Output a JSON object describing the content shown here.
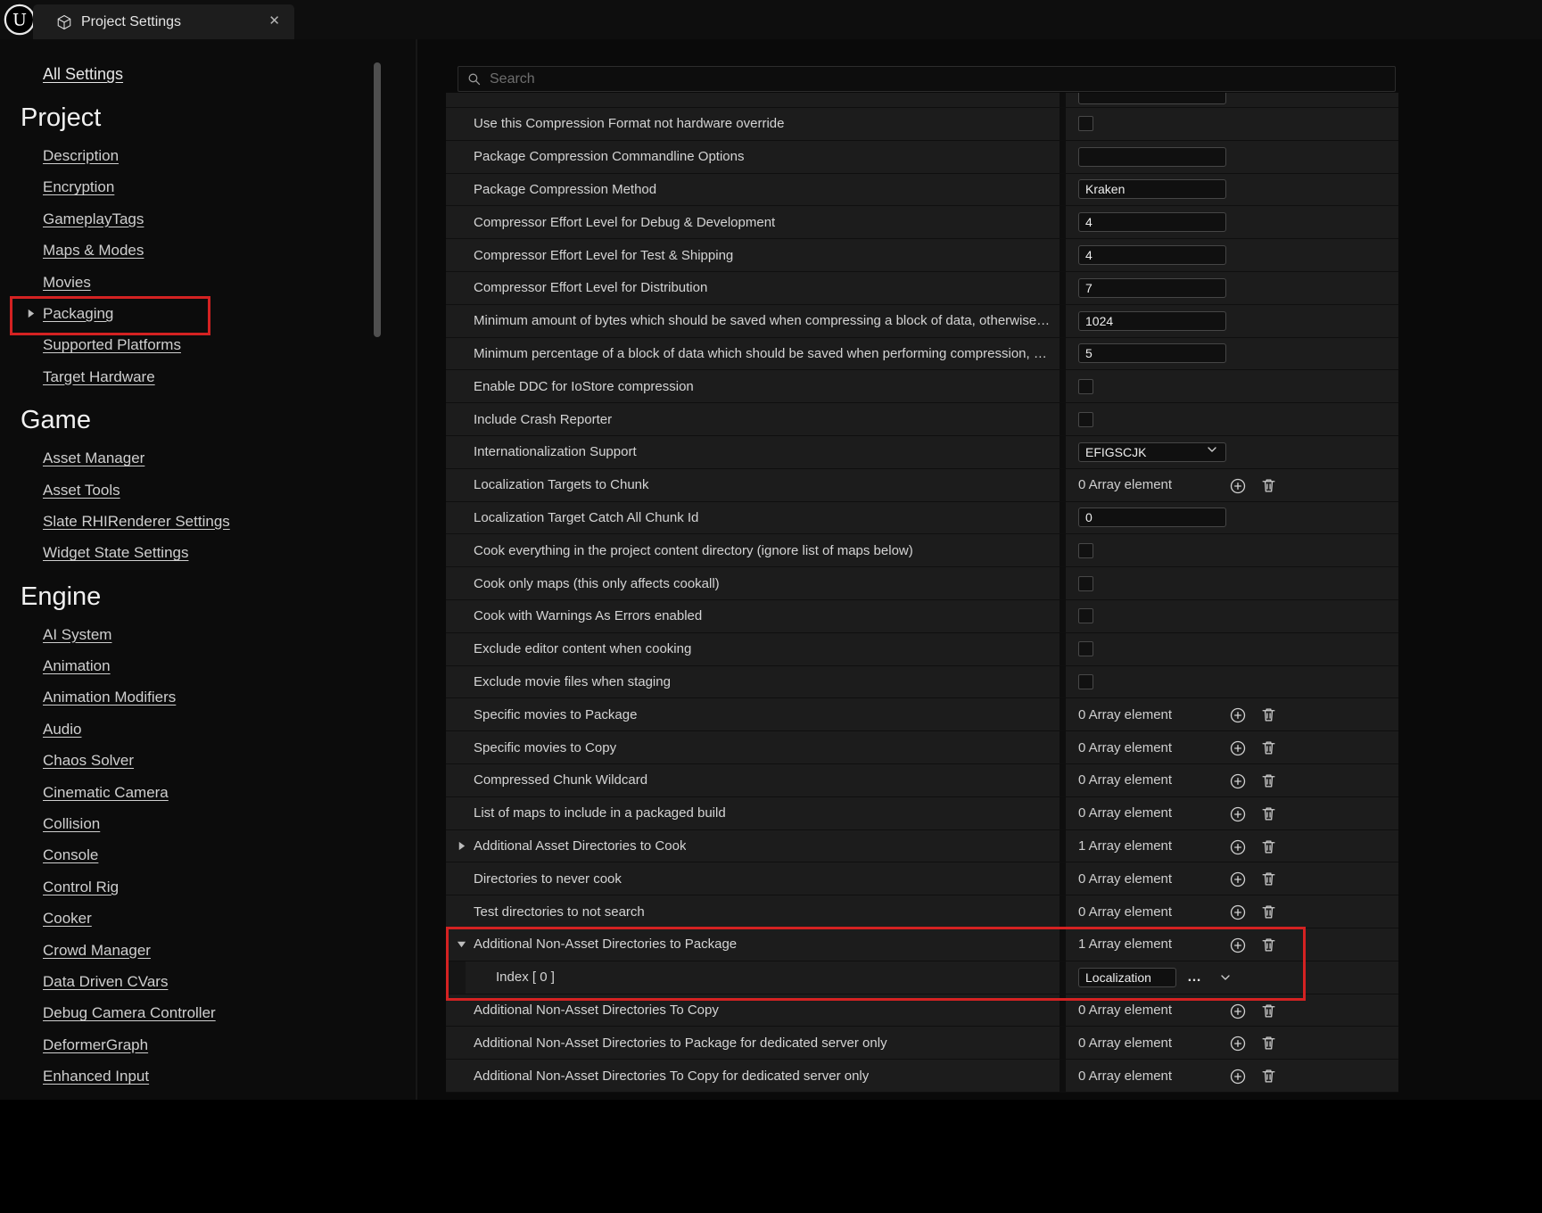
{
  "window": {
    "title": "Project Settings",
    "close_label": "✕"
  },
  "search": {
    "placeholder": "Search"
  },
  "sidebar": {
    "all_settings": "All Settings",
    "selected": "Packaging",
    "sections": [
      {
        "title": "Project",
        "items": [
          "Description",
          "Encryption",
          "GameplayTags",
          "Maps & Modes",
          "Movies",
          "Packaging",
          "Supported Platforms",
          "Target Hardware"
        ]
      },
      {
        "title": "Game",
        "items": [
          "Asset Manager",
          "Asset Tools",
          "Slate RHIRenderer Settings",
          "Widget State Settings"
        ]
      },
      {
        "title": "Engine",
        "items": [
          "AI System",
          "Animation",
          "Animation Modifiers",
          "Audio",
          "Chaos Solver",
          "Cinematic Camera",
          "Collision",
          "Console",
          "Control Rig",
          "Cooker",
          "Crowd Manager",
          "Data Driven CVars",
          "Debug Camera Controller",
          "DeformerGraph",
          "Enhanced Input"
        ]
      }
    ]
  },
  "settings": {
    "ellipsis_label": "…",
    "rows": [
      {
        "label": "Use this Compression Format not hardware override",
        "control": "checkbox",
        "checked": false
      },
      {
        "label": "Package Compression Commandline Options",
        "control": "text",
        "value": ""
      },
      {
        "label": "Package Compression Method",
        "control": "text",
        "value": "Kraken"
      },
      {
        "label": "Compressor Effort Level for Debug & Development",
        "control": "text",
        "value": "4"
      },
      {
        "label": "Compressor Effort Level for Test & Shipping",
        "control": "text",
        "value": "4"
      },
      {
        "label": "Compressor Effort Level for Distribution",
        "control": "text",
        "value": "7"
      },
      {
        "label": "Minimum amount of bytes which should be saved when compressing a block of data, otherwise data…",
        "control": "text",
        "value": "1024"
      },
      {
        "label": "Minimum percentage of a block of data which should be saved when performing compression, other…",
        "control": "text",
        "value": "5"
      },
      {
        "label": "Enable DDC for IoStore compression",
        "control": "checkbox",
        "checked": false
      },
      {
        "label": "Include Crash Reporter",
        "control": "checkbox",
        "checked": false
      },
      {
        "label": "Internationalization Support",
        "control": "dropdown",
        "value": "EFIGSCJK"
      },
      {
        "label": "Localization Targets to Chunk",
        "control": "array",
        "value": "0 Array element"
      },
      {
        "label": "Localization Target Catch All Chunk Id",
        "control": "text",
        "value": "0"
      },
      {
        "label": "Cook everything in the project content directory (ignore list of maps below)",
        "control": "checkbox",
        "checked": false
      },
      {
        "label": "Cook only maps (this only affects cookall)",
        "control": "checkbox",
        "checked": false
      },
      {
        "label": "Cook with Warnings As Errors enabled",
        "control": "checkbox",
        "checked": false
      },
      {
        "label": "Exclude editor content when cooking",
        "control": "checkbox",
        "checked": false
      },
      {
        "label": "Exclude movie files when staging",
        "control": "checkbox",
        "checked": false
      },
      {
        "label": "Specific movies to Package",
        "control": "array",
        "value": "0 Array element"
      },
      {
        "label": "Specific movies to Copy",
        "control": "array",
        "value": "0 Array element"
      },
      {
        "label": "Compressed Chunk Wildcard",
        "control": "array",
        "value": "0 Array element"
      },
      {
        "label": "List of maps to include in a packaged build",
        "control": "array",
        "value": "0 Array element"
      },
      {
        "label": "Additional Asset Directories to Cook",
        "control": "array",
        "value": "1 Array element",
        "expander": "right"
      },
      {
        "label": "Directories to never cook",
        "control": "array",
        "value": "0 Array element"
      },
      {
        "label": "Test directories to not search",
        "control": "array",
        "value": "0 Array element"
      },
      {
        "label": "Additional Non-Asset Directories to Package",
        "control": "array",
        "value": "1 Array element",
        "expander": "down",
        "highlight": true
      },
      {
        "label": "Index [ 0 ]",
        "control": "inline",
        "value": "Localization",
        "child": true,
        "highlight": true
      },
      {
        "label": "Additional Non-Asset Directories To Copy",
        "control": "array",
        "value": "0 Array element"
      },
      {
        "label": "Additional Non-Asset Directories to Package for dedicated server only",
        "control": "array",
        "value": "0 Array element"
      },
      {
        "label": "Additional Non-Asset Directories To Copy for dedicated server only",
        "control": "array",
        "value": "0 Array element"
      }
    ]
  },
  "colors": {
    "highlight_red": "#d42222",
    "row_bg": "#1c1c1c"
  }
}
